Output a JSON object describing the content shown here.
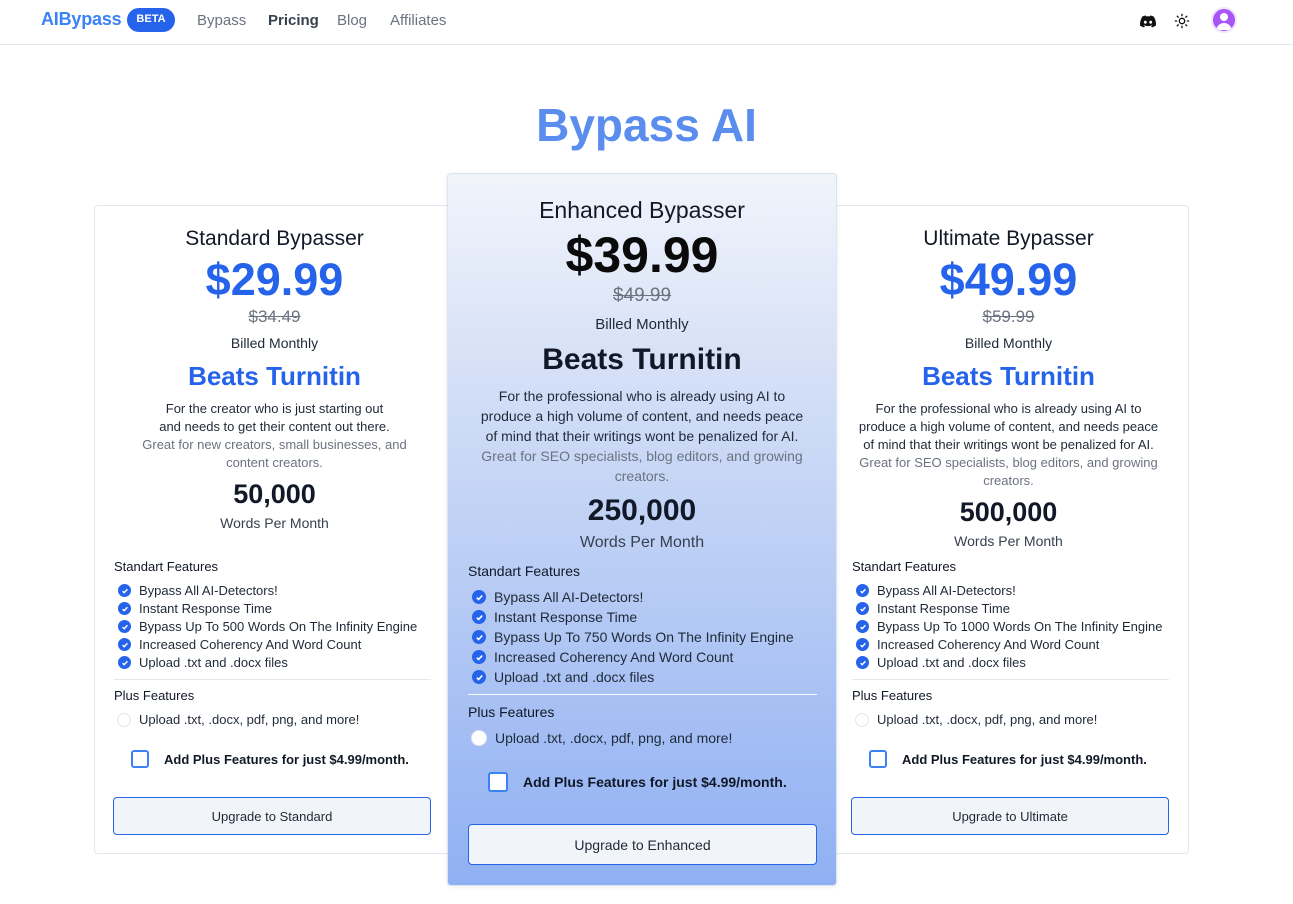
{
  "header": {
    "brand": "AIBypass",
    "badge": "BETA",
    "nav": [
      "Bypass",
      "Pricing",
      "Blog",
      "Affiliates"
    ],
    "icons": [
      "discord-icon",
      "sun-icon",
      "user-avatar-icon"
    ]
  },
  "hero": {
    "title": "Bypass AI"
  },
  "colors": {
    "accent": "#2563eb",
    "hero": "#5b8def",
    "brand": "#3b82f6"
  },
  "plans": [
    {
      "name": "Standard Bypasser",
      "price": "$29.99",
      "old_price": "$34.49",
      "billing": "Billed Monthly",
      "tagline": "Beats Turnitin",
      "desc_main": [
        "For the creator who is just starting out",
        "and needs to get their content out there."
      ],
      "desc_muted": [
        "Great for new creators, small businesses, and",
        "content creators."
      ],
      "words": "50,000",
      "words_label": "Words Per Month",
      "standard_title": "Standart Features",
      "standard_features": [
        "Bypass All AI-Detectors!",
        "Instant Response Time",
        "Bypass Up To 500 Words On The Infinity Engine",
        "Increased Coherency And Word Count",
        "Upload .txt and .docx files"
      ],
      "plus_title": "Plus Features",
      "plus_features": [
        "Upload .txt, .docx, pdf, png, and more!"
      ],
      "addon_label": "Add Plus Features for just $4.99/month.",
      "cta": "Upgrade to Standard"
    },
    {
      "name": "Enhanced Bypasser",
      "price": "$39.99",
      "old_price": "$49.99",
      "billing": "Billed Monthly",
      "tagline": "Beats Turnitin",
      "desc_main": [
        "For the professional who is already using AI to",
        "produce a high volume of content, and needs peace",
        "of mind that their writings wont be penalized for AI."
      ],
      "desc_muted": [
        "Great for SEO specialists, blog editors, and growing",
        "creators."
      ],
      "words": "250,000",
      "words_label": "Words Per Month",
      "standard_title": "Standart Features",
      "standard_features": [
        "Bypass All AI-Detectors!",
        "Instant Response Time",
        "Bypass Up To 750 Words On The Infinity Engine",
        "Increased Coherency And Word Count",
        "Upload .txt and .docx files"
      ],
      "plus_title": "Plus Features",
      "plus_features": [
        "Upload .txt, .docx, pdf, png, and more!"
      ],
      "addon_label": "Add Plus Features for just $4.99/month.",
      "cta": "Upgrade to Enhanced"
    },
    {
      "name": "Ultimate Bypasser",
      "price": "$49.99",
      "old_price": "$59.99",
      "billing": "Billed Monthly",
      "tagline": "Beats Turnitin",
      "desc_main": [
        "For the professional who is already using AI to",
        "produce a high volume of content, and needs peace",
        "of mind that their writings wont be penalized for AI."
      ],
      "desc_muted": [
        "Great for SEO specialists, blog editors, and growing",
        "creators."
      ],
      "words": "500,000",
      "words_label": "Words Per Month",
      "standard_title": "Standart Features",
      "standard_features": [
        "Bypass All AI-Detectors!",
        "Instant Response Time",
        "Bypass Up To 1000 Words On The Infinity Engine",
        "Increased Coherency And Word Count",
        "Upload .txt and .docx files"
      ],
      "plus_title": "Plus Features",
      "plus_features": [
        "Upload .txt, .docx, pdf, png, and more!"
      ],
      "addon_label": "Add Plus Features for just $4.99/month.",
      "cta": "Upgrade to Ultimate"
    }
  ]
}
